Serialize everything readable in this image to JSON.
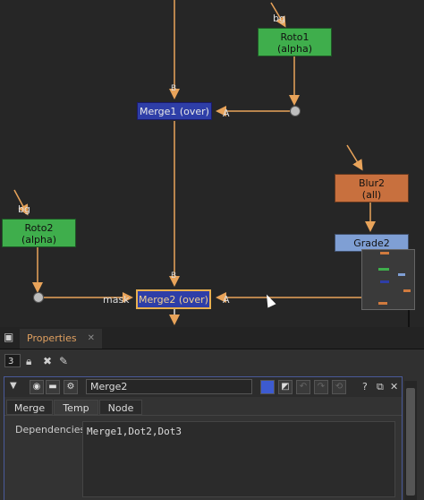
{
  "graph": {
    "nodes": {
      "roto1": {
        "name": "Roto1",
        "sub": "(alpha)"
      },
      "merge1": {
        "name": "Merge1 (over)"
      },
      "blur2": {
        "name": "Blur2",
        "sub": "(all)"
      },
      "grade2": {
        "name": "Grade2"
      },
      "roto2": {
        "name": "Roto2",
        "sub": "(alpha)"
      },
      "merge2": {
        "name": "Merge2 (over)"
      }
    },
    "labels": {
      "bg_roto1": "bg",
      "bg_roto2": "bg",
      "b_merge1": "B",
      "b_merge2": "B",
      "a_merge1": "A",
      "a_merge2": "A",
      "mask": "mask"
    }
  },
  "panel": {
    "tab_label": "Properties",
    "tab_close": "✕",
    "max_panels": "3",
    "node_name": "Merge2",
    "tabs": [
      "Merge",
      "Temp",
      "Node"
    ],
    "dependencies_label": "Dependencies",
    "dependencies_value": "Merge1,Dot2,Dot3",
    "btn_help": "?",
    "btn_close": "✕"
  }
}
